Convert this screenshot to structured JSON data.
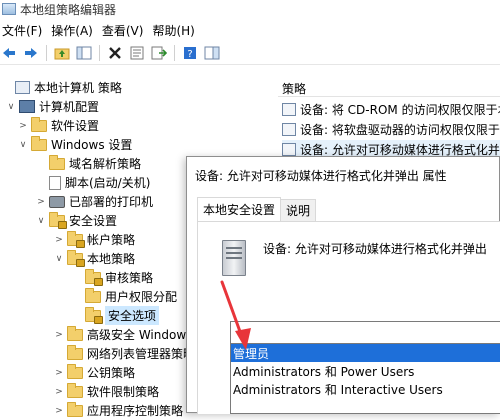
{
  "window": {
    "title": "本地组策略编辑器"
  },
  "menubar": [
    "文件(F)",
    "操作(A)",
    "查看(V)",
    "帮助(H)"
  ],
  "toolbar_icons": [
    "back-icon",
    "forward-icon",
    "up-folder-icon",
    "show-tree-icon",
    "delete-icon",
    "properties-icon",
    "export-icon",
    "help-icon",
    "panel-icon"
  ],
  "tree": [
    {
      "label": "本地计算机 策略",
      "icon": "policy-icon",
      "level": 0,
      "chevron": ""
    },
    {
      "label": "计算机配置",
      "icon": "pc-icon",
      "level": 1,
      "chevron": "∨"
    },
    {
      "label": "软件设置",
      "icon": "folder",
      "level": 2,
      "chevron": ">"
    },
    {
      "label": "Windows 设置",
      "icon": "folder",
      "level": 2,
      "chevron": "∨"
    },
    {
      "label": "域名解析策略",
      "icon": "folder",
      "level": 3,
      "chevron": ""
    },
    {
      "label": "脚本(启动/关机)",
      "icon": "doc-icon",
      "level": 3,
      "chevron": ""
    },
    {
      "label": "已部署的打印机",
      "icon": "printer-icon",
      "level": 3,
      "chevron": ">"
    },
    {
      "label": "安全设置",
      "icon": "folder-lock",
      "level": 3,
      "chevron": "∨"
    },
    {
      "label": "帐户策略",
      "icon": "folder-lock",
      "level": 4,
      "chevron": ">"
    },
    {
      "label": "本地策略",
      "icon": "folder-lock",
      "level": 4,
      "chevron": "∨"
    },
    {
      "label": "审核策略",
      "icon": "folder-lock",
      "level": 5,
      "chevron": ""
    },
    {
      "label": "用户权限分配",
      "icon": "folder",
      "level": 5,
      "chevron": ""
    },
    {
      "label": "安全选项",
      "icon": "folder-lock",
      "level": 5,
      "chevron": "",
      "selected": true
    },
    {
      "label": "高级安全 Windows",
      "icon": "folder",
      "level": 4,
      "chevron": ">"
    },
    {
      "label": "网络列表管理器策略",
      "icon": "folder",
      "level": 4,
      "chevron": ""
    },
    {
      "label": "公钥策略",
      "icon": "folder",
      "level": 4,
      "chevron": ">"
    },
    {
      "label": "软件限制策略",
      "icon": "folder",
      "level": 4,
      "chevron": ">"
    },
    {
      "label": "应用程序控制策略",
      "icon": "folder",
      "level": 4,
      "chevron": ">"
    }
  ],
  "right_pane": {
    "header": "策略",
    "rows": [
      "设备: 将 CD-ROM 的访问权限仅限于本地",
      "设备: 将软盘驱动器的访问权限仅限于本地",
      "设备: 允许对可移动媒体进行格式化并弹出"
    ]
  },
  "dialog": {
    "title": "设备: 允许对可移动媒体进行格式化并弹出 属性",
    "tabs": [
      "本地安全设置",
      "说明"
    ],
    "policy_name": "设备: 允许对可移动媒体进行格式化并弹出",
    "dropdown_options": [
      "管理员",
      "Administrators 和 Power Users",
      "Administrators 和 Interactive Users"
    ],
    "selected_option": "管理员"
  },
  "colors": {
    "selection": "#1e6fd9",
    "arrow": "#e8353a",
    "tree_highlight": "#cce8ff"
  }
}
